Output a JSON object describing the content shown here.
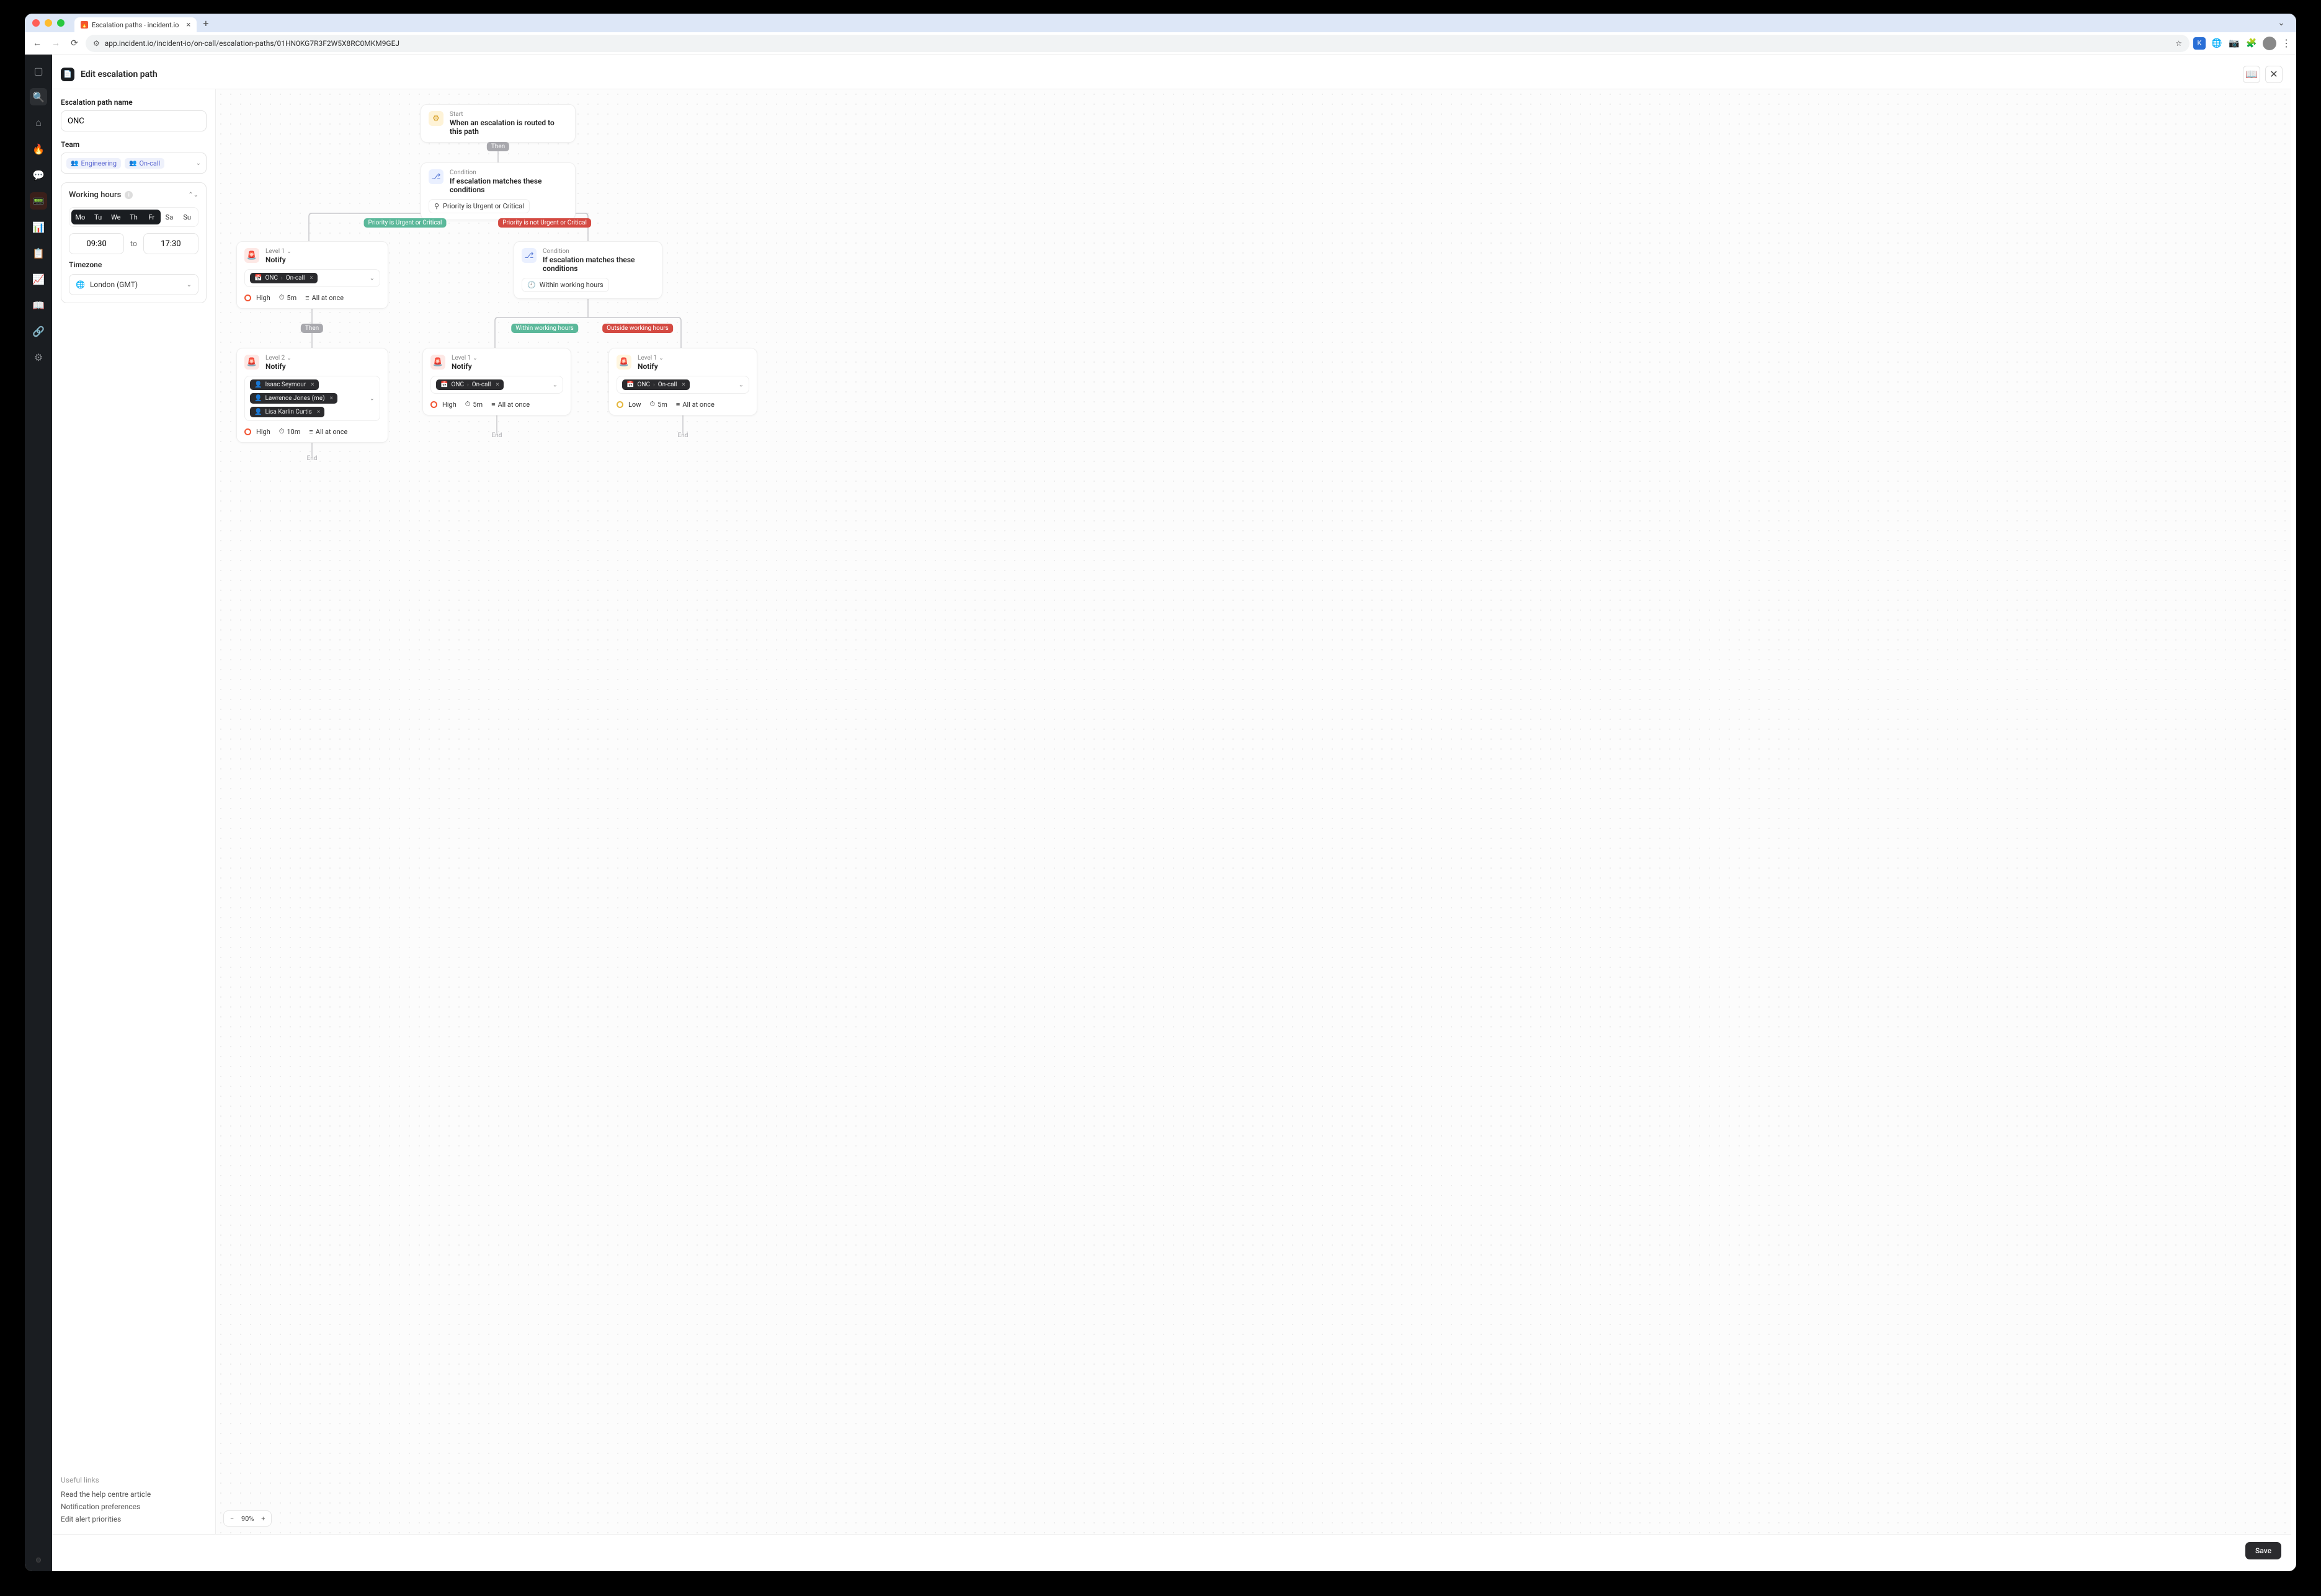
{
  "browser": {
    "tab_title": "Escalation paths - incident.io",
    "url": "app.incident.io/incident-io/on-call/escalation-paths/01HN0KG7R3F2W5X8RC0MKM9GEJ"
  },
  "rail_icons": [
    "dashboard",
    "search",
    "home",
    "flame",
    "bell",
    "oncall",
    "bars",
    "clipboard",
    "chart",
    "book",
    "sitemap",
    "gear"
  ],
  "header": {
    "title": "Edit escalation path"
  },
  "form": {
    "name_label": "Escalation path name",
    "name_value": "ONC",
    "team_label": "Team",
    "team_values": [
      "Engineering",
      "On-call"
    ],
    "working_hours_label": "Working hours",
    "days": [
      "Mo",
      "Tu",
      "We",
      "Th",
      "Fr",
      "Sa",
      "Su"
    ],
    "active_days": [
      "Mo",
      "Tu",
      "We",
      "Th",
      "Fr"
    ],
    "time_from": "09:30",
    "time_to_label": "to",
    "time_to": "17:30",
    "timezone_label": "Timezone",
    "timezone_value": "London (GMT)"
  },
  "useful_links": {
    "heading": "Useful links",
    "items": [
      "Read the help centre article",
      "Notification preferences",
      "Edit alert priorities"
    ]
  },
  "flow": {
    "start": {
      "overline": "Start",
      "title": "When an escalation is routed to this path"
    },
    "then1": "Then",
    "cond1": {
      "overline": "Condition",
      "title": "If escalation matches these conditions",
      "chip": "Priority is Urgent or Critical"
    },
    "branch1_true": "Priority is Urgent or Critical",
    "branch1_false": "Priority is not Urgent or Critical",
    "notifyA": {
      "overline": "Level 1",
      "title": "Notify",
      "targets_schedule": "ONC",
      "targets_role": "On-call",
      "urgency": "High",
      "timeout": "5m",
      "order": "All at once"
    },
    "then2": "Then",
    "notifyB": {
      "overline": "Level 2",
      "title": "Notify",
      "targets": [
        "Isaac Seymour",
        "Lawrence Jones (me)",
        "Lisa Karlin Curtis"
      ],
      "urgency": "High",
      "timeout": "10m",
      "order": "All at once"
    },
    "cond2": {
      "overline": "Condition",
      "title": "If escalation matches these conditions",
      "chip": "Within working hours"
    },
    "branch2_true": "Within working hours",
    "branch2_false": "Outside working hours",
    "notifyC": {
      "overline": "Level 1",
      "title": "Notify",
      "targets_schedule": "ONC",
      "targets_role": "On-call",
      "urgency": "High",
      "timeout": "5m",
      "order": "All at once"
    },
    "notifyD": {
      "overline": "Level 1",
      "title": "Notify",
      "targets_schedule": "ONC",
      "targets_role": "On-call",
      "urgency": "Low",
      "timeout": "5m",
      "order": "All at once"
    },
    "end": "End"
  },
  "zoom": {
    "value": "90%"
  },
  "footer": {
    "save": "Save"
  }
}
